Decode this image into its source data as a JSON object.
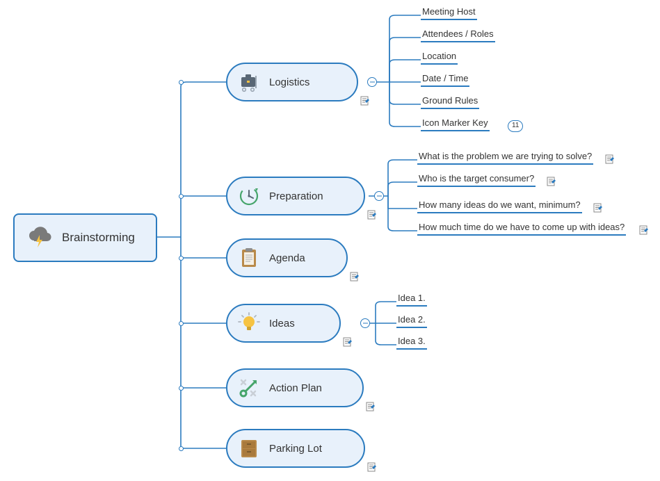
{
  "root": {
    "label": "Brainstorming"
  },
  "branches": [
    {
      "id": "logistics",
      "label": "Logistics",
      "has_note": true
    },
    {
      "id": "preparation",
      "label": "Preparation",
      "has_note": true
    },
    {
      "id": "agenda",
      "label": "Agenda",
      "has_note": true
    },
    {
      "id": "ideas",
      "label": "Ideas",
      "has_note": true
    },
    {
      "id": "actionplan",
      "label": "Action Plan",
      "has_note": true
    },
    {
      "id": "parkinglot",
      "label": "Parking Lot",
      "has_note": true
    }
  ],
  "logistics_children": [
    "Meeting Host",
    "Attendees / Roles",
    "Location",
    "Date / Time",
    "Ground Rules",
    "Icon Marker Key"
  ],
  "preparation_children": [
    "What is the problem we are trying to solve?",
    "Who is the target consumer?",
    "How many ideas do we want, minimum?",
    "How much time do we have to come up with ideas?"
  ],
  "ideas_children": [
    "Idea 1.",
    "Idea 2.",
    "Idea 3."
  ],
  "logistics_marker_count": "11"
}
